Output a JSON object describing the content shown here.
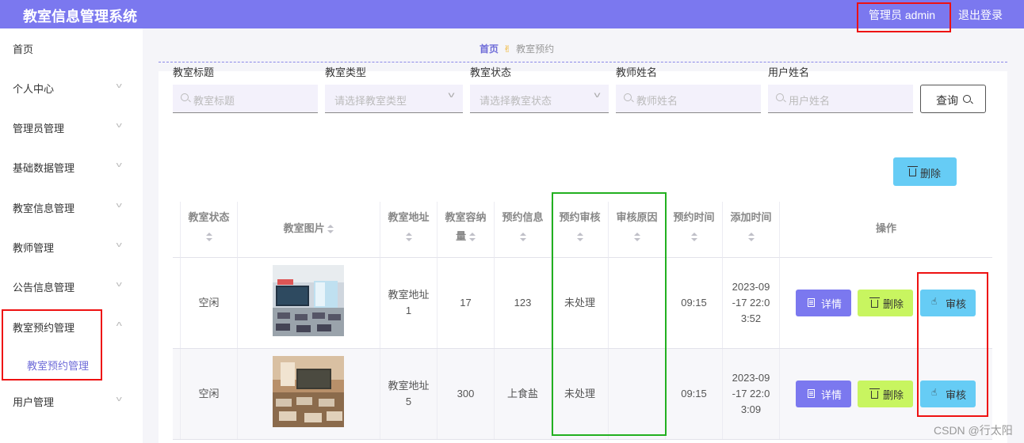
{
  "header": {
    "title": "教室信息管理系统",
    "admin_label": "管理员 admin",
    "logout_label": "退出登录"
  },
  "sidebar": {
    "items": [
      {
        "label": "首页",
        "has_arrow": false
      },
      {
        "label": "个人中心",
        "has_arrow": true
      },
      {
        "label": "管理员管理",
        "has_arrow": true
      },
      {
        "label": "基础数据管理",
        "has_arrow": true
      },
      {
        "label": "教室信息管理",
        "has_arrow": true
      },
      {
        "label": "教师管理",
        "has_arrow": true
      },
      {
        "label": "公告信息管理",
        "has_arrow": true
      },
      {
        "label": "教室预约管理",
        "has_arrow": true,
        "expanded": true
      },
      {
        "label": "用户管理",
        "has_arrow": true
      }
    ],
    "submenu_label": "教室预约管理"
  },
  "breadcrumb": {
    "home": "首页",
    "separator": "✌",
    "current": "教室预约"
  },
  "filters": {
    "title_label": "教室标题",
    "title_placeholder": "教室标题",
    "type_label": "教室类型",
    "type_placeholder": "请选择教室类型",
    "status_label": "教室状态",
    "status_placeholder": "请选择教室状态",
    "teacher_label": "教师姓名",
    "teacher_placeholder": "教师姓名",
    "user_label": "用户姓名",
    "user_placeholder": "用户姓名",
    "query_label": "查询",
    "delete_label": "删除"
  },
  "table": {
    "headers": {
      "status": "教室状态",
      "image": "教室图片",
      "address": "教室地址",
      "capacity_1": "教室容纳",
      "capacity_2": "量",
      "info": "预约信息",
      "review": "预约审核",
      "reason": "审核原因",
      "time": "预约时间",
      "added": "添加时间",
      "actions": "操作"
    },
    "rows": [
      {
        "status": "空闲",
        "address_1": "教室地址",
        "address_2": "1",
        "capacity": "17",
        "info": "123",
        "review": "未处理",
        "reason": "",
        "time": "09:15",
        "added_1": "2023-09",
        "added_2": "-17 22:0",
        "added_3": "3:52"
      },
      {
        "status": "空闲",
        "address_1": "教室地址",
        "address_2": "5",
        "capacity": "300",
        "info": "上食盐",
        "review": "未处理",
        "reason": "",
        "time": "09:15",
        "added_1": "2023-09",
        "added_2": "-17 22:0",
        "added_3": "3:09"
      }
    ],
    "actions": {
      "detail": "详情",
      "delete": "删除",
      "audit": "审核"
    }
  },
  "watermark": "CSDN @行太阳",
  "colors": {
    "header_bg": "#7b78ef",
    "detail_btn": "#7b78ef",
    "delete_btn": "#c8f560",
    "audit_btn": "#66ccf5",
    "annotation_red": "#ee1111",
    "annotation_green": "#22b020"
  }
}
